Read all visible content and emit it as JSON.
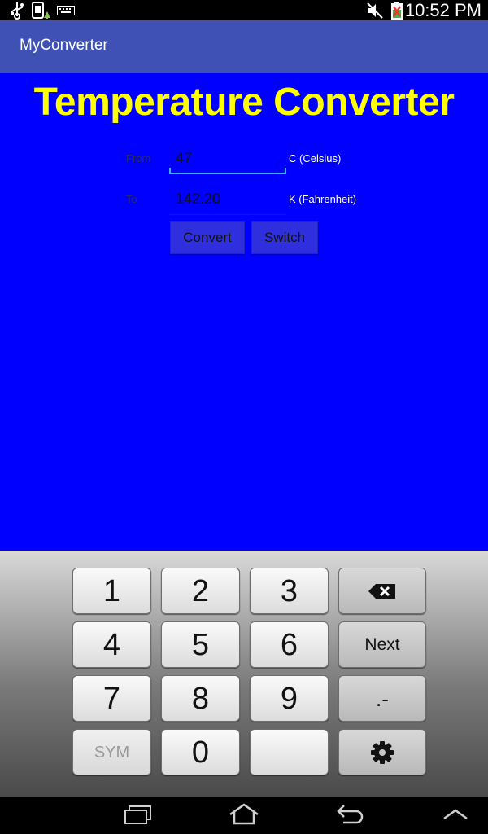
{
  "status_bar": {
    "time": "10:52 PM",
    "icons": [
      "usb-icon",
      "screenshot-icon",
      "keyboard-icon",
      "mute-icon",
      "battery-icon"
    ]
  },
  "app": {
    "title": "MyConverter"
  },
  "converter": {
    "heading": "Temperature Converter",
    "from_label": "From",
    "to_label": "To",
    "from_value": "47",
    "to_value": "142.20",
    "from_unit": "C (Celsius)",
    "to_unit": "K (Fahrenheit)",
    "convert_label": "Convert",
    "switch_label": "Switch",
    "colors": {
      "background": "#0000FF",
      "heading": "#FFFF00",
      "action_bar": "#3F51B5",
      "focus_underline": "#33B5E5"
    }
  },
  "keyboard": {
    "rows": [
      [
        "1",
        "2",
        "3",
        "backspace-icon"
      ],
      [
        "4",
        "5",
        "6",
        "Next"
      ],
      [
        "7",
        "8",
        "9",
        ".-"
      ],
      [
        "SYM",
        "0",
        "",
        "settings-icon"
      ]
    ]
  },
  "nav_bar": {
    "icons": [
      "recent-apps-icon",
      "home-icon",
      "back-icon",
      "hide-keyboard-icon"
    ]
  }
}
